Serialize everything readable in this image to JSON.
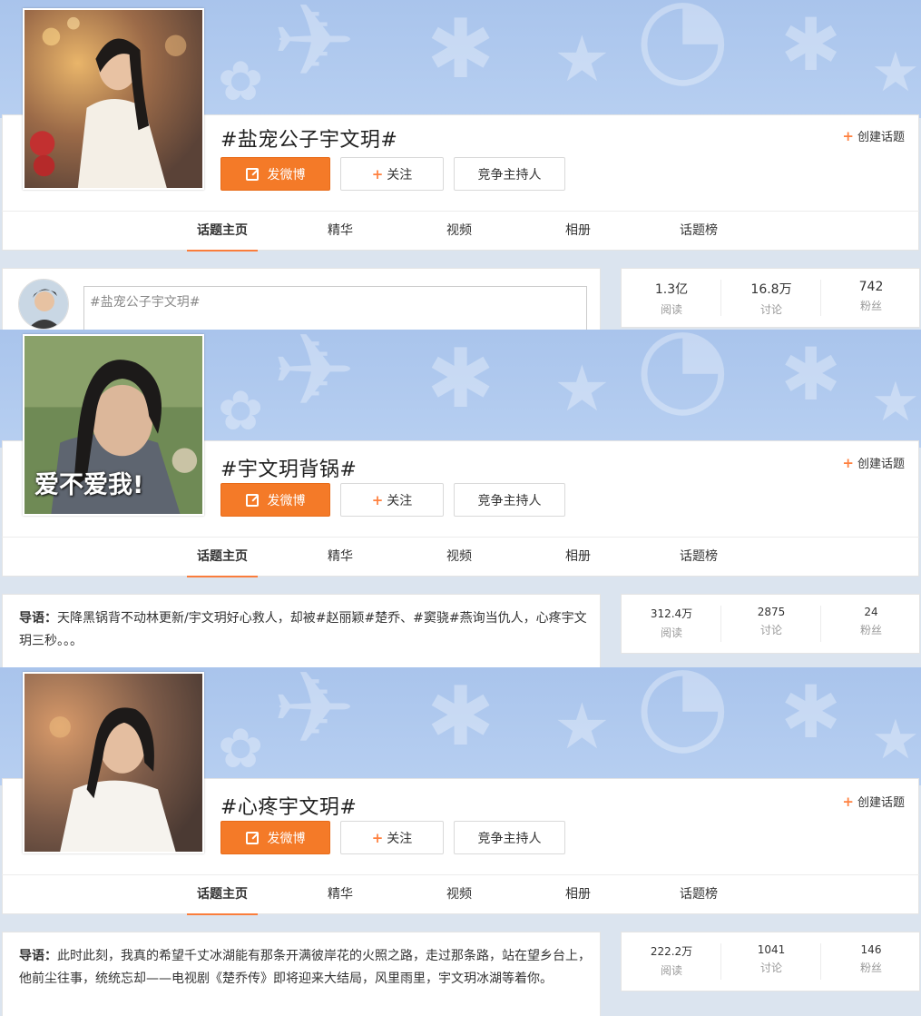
{
  "sections": [
    {
      "title": "#盐宠公子宇文玥#",
      "create_topic": "创建话题",
      "buttons": {
        "post": "发微博",
        "follow": "关注",
        "host": "竞争主持人"
      },
      "tabs": [
        "话题主页",
        "精华",
        "视频",
        "相册",
        "话题榜"
      ],
      "composer_placeholder": "#盐宠公子宇文玥#",
      "stats": [
        {
          "value": "1.3亿",
          "label": "阅读"
        },
        {
          "value": "16.8万",
          "label": "讨论"
        },
        {
          "value": "742",
          "label": "粉丝"
        }
      ]
    },
    {
      "title": "#宇文玥背锅#",
      "cover_caption": "爱不爱我!",
      "create_topic": "创建话题",
      "buttons": {
        "post": "发微博",
        "follow": "关注",
        "host": "竞争主持人"
      },
      "tabs": [
        "话题主页",
        "精华",
        "视频",
        "相册",
        "话题榜"
      ],
      "lead_label": "导语：",
      "lead_text": "天降黑锅背不动林更新/宇文玥好心救人，却被#赵丽颖#楚乔、#窦骁#燕询当仇人，心疼宇文玥三秒。。。",
      "stats": [
        {
          "value": "312.4万",
          "label": "阅读"
        },
        {
          "value": "2875",
          "label": "讨论"
        },
        {
          "value": "24",
          "label": "粉丝"
        }
      ]
    },
    {
      "title": "#心疼宇文玥#",
      "create_topic": "创建话题",
      "buttons": {
        "post": "发微博",
        "follow": "关注",
        "host": "竞争主持人"
      },
      "tabs": [
        "话题主页",
        "精华",
        "视频",
        "相册",
        "话题榜"
      ],
      "lead_label": "导语：",
      "lead_text": "此时此刻，我真的希望千丈冰湖能有那条开满彼岸花的火照之路，走过那条路，站在望乡台上，他前尘往事，统统忘却——电视剧《楚乔传》即将迎来大结局，风里雨里，宇文玥冰湖等着你。",
      "stats": [
        {
          "value": "222.2万",
          "label": "阅读"
        },
        {
          "value": "1041",
          "label": "讨论"
        },
        {
          "value": "146",
          "label": "粉丝"
        }
      ]
    }
  ],
  "colors": {
    "accent": "#f47a28",
    "banner": "#b0c9ee",
    "tab_underline": "#fa7d3c"
  },
  "icons": [
    "edit-icon",
    "plus-icon"
  ]
}
